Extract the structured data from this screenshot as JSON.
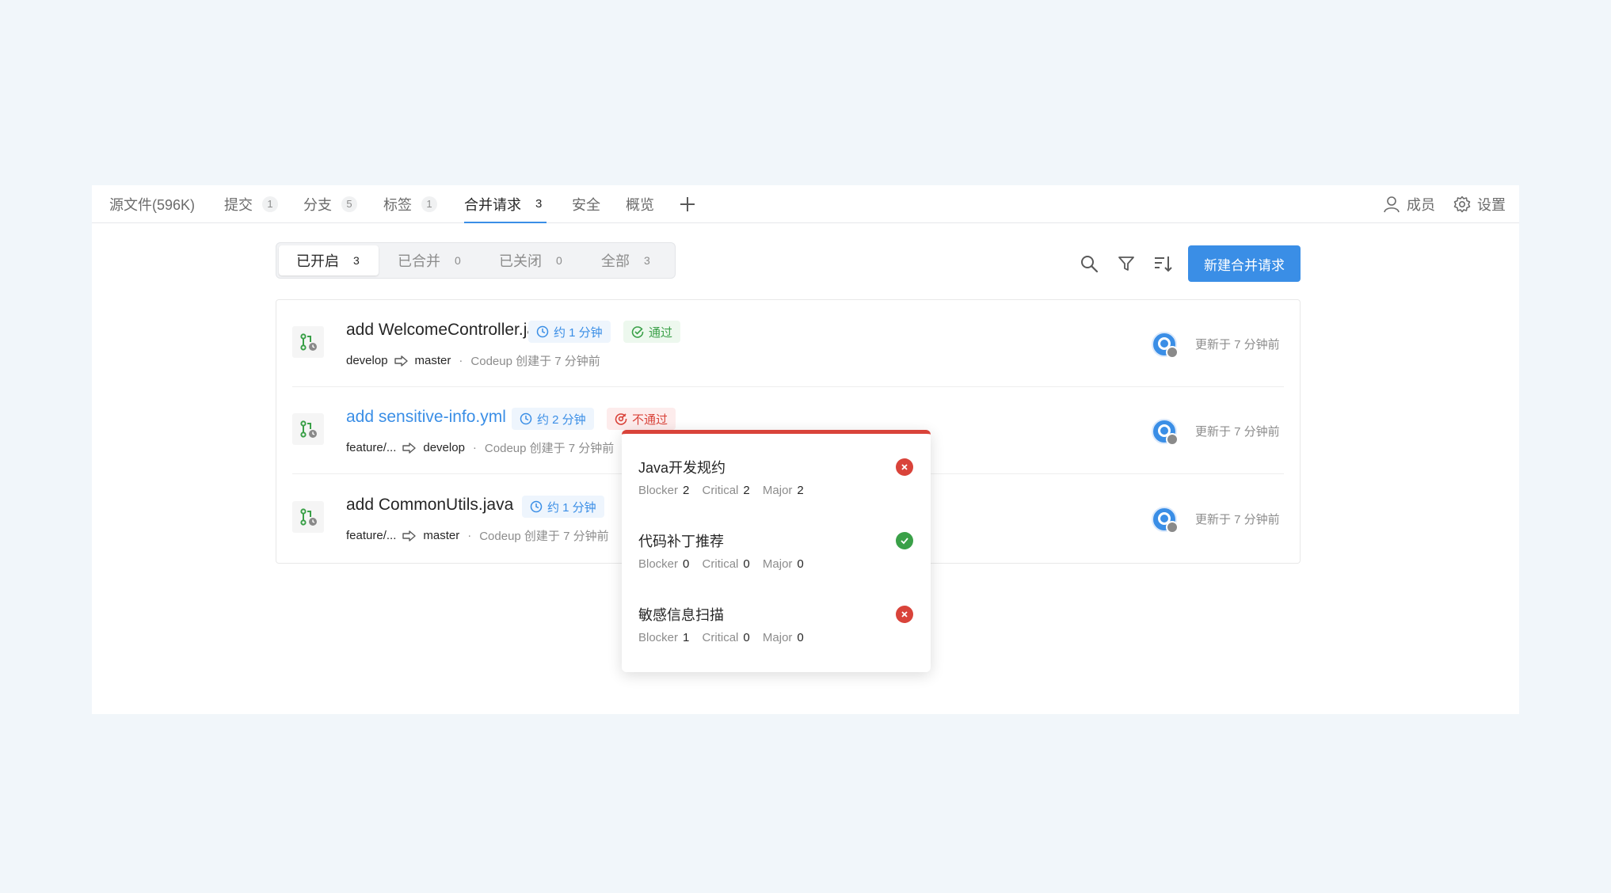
{
  "colors": {
    "accent": "#3a8ee6",
    "pass": "#3aa048",
    "fail": "#d9433a",
    "background": "#f1f6fa"
  },
  "topnav": {
    "tabs": [
      {
        "label": "源文件(596K)",
        "count": ""
      },
      {
        "label": "提交",
        "count": "1"
      },
      {
        "label": "分支",
        "count": "5"
      },
      {
        "label": "标签",
        "count": "1"
      },
      {
        "label": "合并请求",
        "count": "3"
      },
      {
        "label": "安全",
        "count": ""
      },
      {
        "label": "概览",
        "count": ""
      }
    ],
    "active_tab": "合并请求",
    "plus_icon": "plus-icon",
    "members_label": "成员",
    "settings_label": "设置"
  },
  "filter_tabs": [
    {
      "label": "已开启",
      "count": "3"
    },
    {
      "label": "已合并",
      "count": "0"
    },
    {
      "label": "已关闭",
      "count": "0"
    },
    {
      "label": "全部",
      "count": "3"
    }
  ],
  "active_filter": "已开启",
  "toolbar": {
    "icons": [
      "search-icon",
      "filter-icon",
      "sort-icon"
    ],
    "new_button": "新建合并请求"
  },
  "merge_requests": [
    {
      "title": "add WelcomeController.java",
      "time_tag": "约 1 分钟",
      "status_tag": "通过",
      "source": "develop",
      "target": "master",
      "created": "Codeup 创建于 7 分钟前",
      "updated": "更新于 7 分钟前"
    },
    {
      "title": "add sensitive-info.yml",
      "time_tag": "约 2 分钟",
      "status_tag": "不通过",
      "source": "feature/...",
      "target": "develop",
      "created": "Codeup 创建于 7 分钟前",
      "updated": "更新于 7 分钟前"
    },
    {
      "title": "add CommonUtils.java",
      "time_tag": "约 1 分钟",
      "status_tag": "",
      "source": "feature/...",
      "target": "master",
      "created": "Codeup 创建于 7 分钟前",
      "updated": "更新于 7 分钟前"
    }
  ],
  "popover": {
    "checks": [
      {
        "name": "Java开发规约",
        "status": "fail",
        "blocker": "2",
        "critical": "2",
        "major": "2"
      },
      {
        "name": "代码补丁推荐",
        "status": "pass",
        "blocker": "0",
        "critical": "0",
        "major": "0"
      },
      {
        "name": "敏感信息扫描",
        "status": "fail",
        "blocker": "1",
        "critical": "0",
        "major": "0"
      }
    ],
    "labels": {
      "blocker": "Blocker",
      "critical": "Critical",
      "major": "Major"
    }
  }
}
